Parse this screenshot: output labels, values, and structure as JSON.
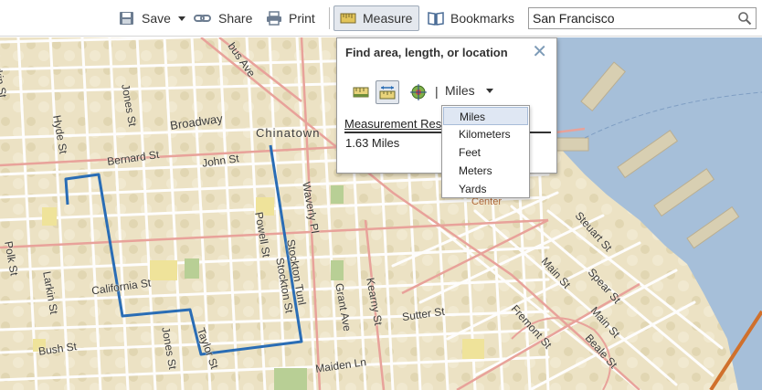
{
  "toolbar": {
    "save_label": "Save",
    "share_label": "Share",
    "print_label": "Print",
    "measure_label": "Measure",
    "bookmarks_label": "Bookmarks"
  },
  "search": {
    "value": "San Francisco"
  },
  "measure_panel": {
    "title": "Find area, length, or location",
    "tools": [
      "area-tool-icon",
      "distance-tool-icon",
      "location-tool-icon"
    ],
    "active_tool": "distance-tool-icon",
    "separator": "|",
    "unit_selected": "Miles",
    "result_heading": "Measurement Result",
    "result_value": "1.63 Miles"
  },
  "unit_options": [
    "Miles",
    "Kilometers",
    "Feet",
    "Meters",
    "Yards"
  ],
  "map": {
    "labels": {
      "larkin_top": "Larkin St",
      "jones_top": "Jones St",
      "bus_ave": "bus Ave",
      "broadway": "Broadway",
      "hyde": "Hyde St",
      "chinatown": "Chinatown",
      "bernard": "Bernard St",
      "john": "John St",
      "waverly": "Waverly Pl",
      "powell": "Powell St",
      "stockton_tunl": "Stockton Tunl",
      "stockton": "Stockton St",
      "polk": "Polk St",
      "larkin": "Larkin St",
      "california": "California St",
      "grant": "Grant Ave",
      "kearny": "Kearny St",
      "sutter": "Sutter St",
      "bush": "Bush St",
      "jones": "Jones St",
      "taylor": "Taylor St",
      "maiden": "Maiden Ln",
      "center": "Center",
      "steuart": "Steuart St",
      "main_top": "Main St",
      "spear": "Spear St",
      "main": "Main St",
      "fremont": "Fremont St",
      "beale": "Beale St"
    },
    "colors": {
      "land": "#ece2c4",
      "water": "#a6bfd9",
      "arterial": "#e8a29a",
      "street": "#ffffff",
      "measure_line": "#2a6db5",
      "park": "#b8cf95",
      "highlight": "#efe39a"
    }
  }
}
